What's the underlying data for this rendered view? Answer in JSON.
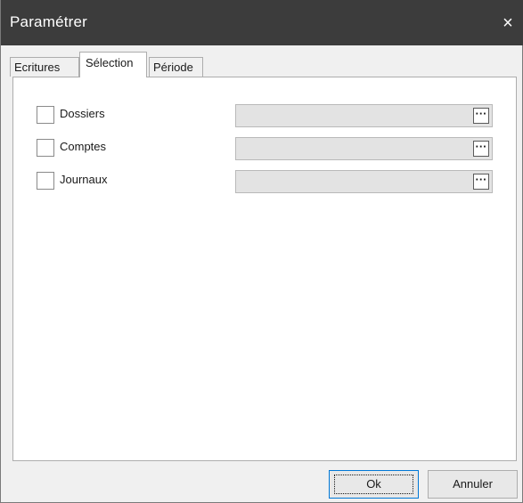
{
  "window": {
    "title": "Paramétrer",
    "close_glyph": "×"
  },
  "tabs": [
    {
      "label": "Ecritures",
      "active": false
    },
    {
      "label": "Sélection",
      "active": true
    },
    {
      "label": "Période",
      "active": false
    }
  ],
  "selection": {
    "rows": [
      {
        "label": "Dossiers",
        "checked": false,
        "value": "",
        "browse_glyph": "···"
      },
      {
        "label": "Comptes",
        "checked": false,
        "value": "",
        "browse_glyph": "···"
      },
      {
        "label": "Journaux",
        "checked": false,
        "value": "",
        "browse_glyph": "···"
      }
    ]
  },
  "buttons": {
    "ok_label": "Ok",
    "cancel_label": "Annuler"
  },
  "colors": {
    "titlebar": "#3c3c3c",
    "accent": "#0078d7"
  }
}
